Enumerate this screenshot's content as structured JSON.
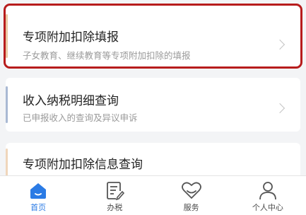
{
  "cards": [
    {
      "title": "专项附加扣除填报",
      "subtitle": "子女教育、继续教育等专项附加扣除的填报"
    },
    {
      "title": "收入纳税明细查询",
      "subtitle": "已申报收入的查询及异议申诉"
    },
    {
      "title": "专项附加扣除信息查询"
    }
  ],
  "tabbar": {
    "tabs": [
      {
        "label": "首页",
        "icon": "home-icon",
        "active": true
      },
      {
        "label": "办税",
        "icon": "tax-form-icon"
      },
      {
        "label": "服务",
        "icon": "service-heart-icon"
      },
      {
        "label": "个人中心",
        "icon": "person-icon"
      }
    ]
  },
  "colors": {
    "highlight_border": "#b71c1c",
    "active_tab": "#2b7be5"
  }
}
